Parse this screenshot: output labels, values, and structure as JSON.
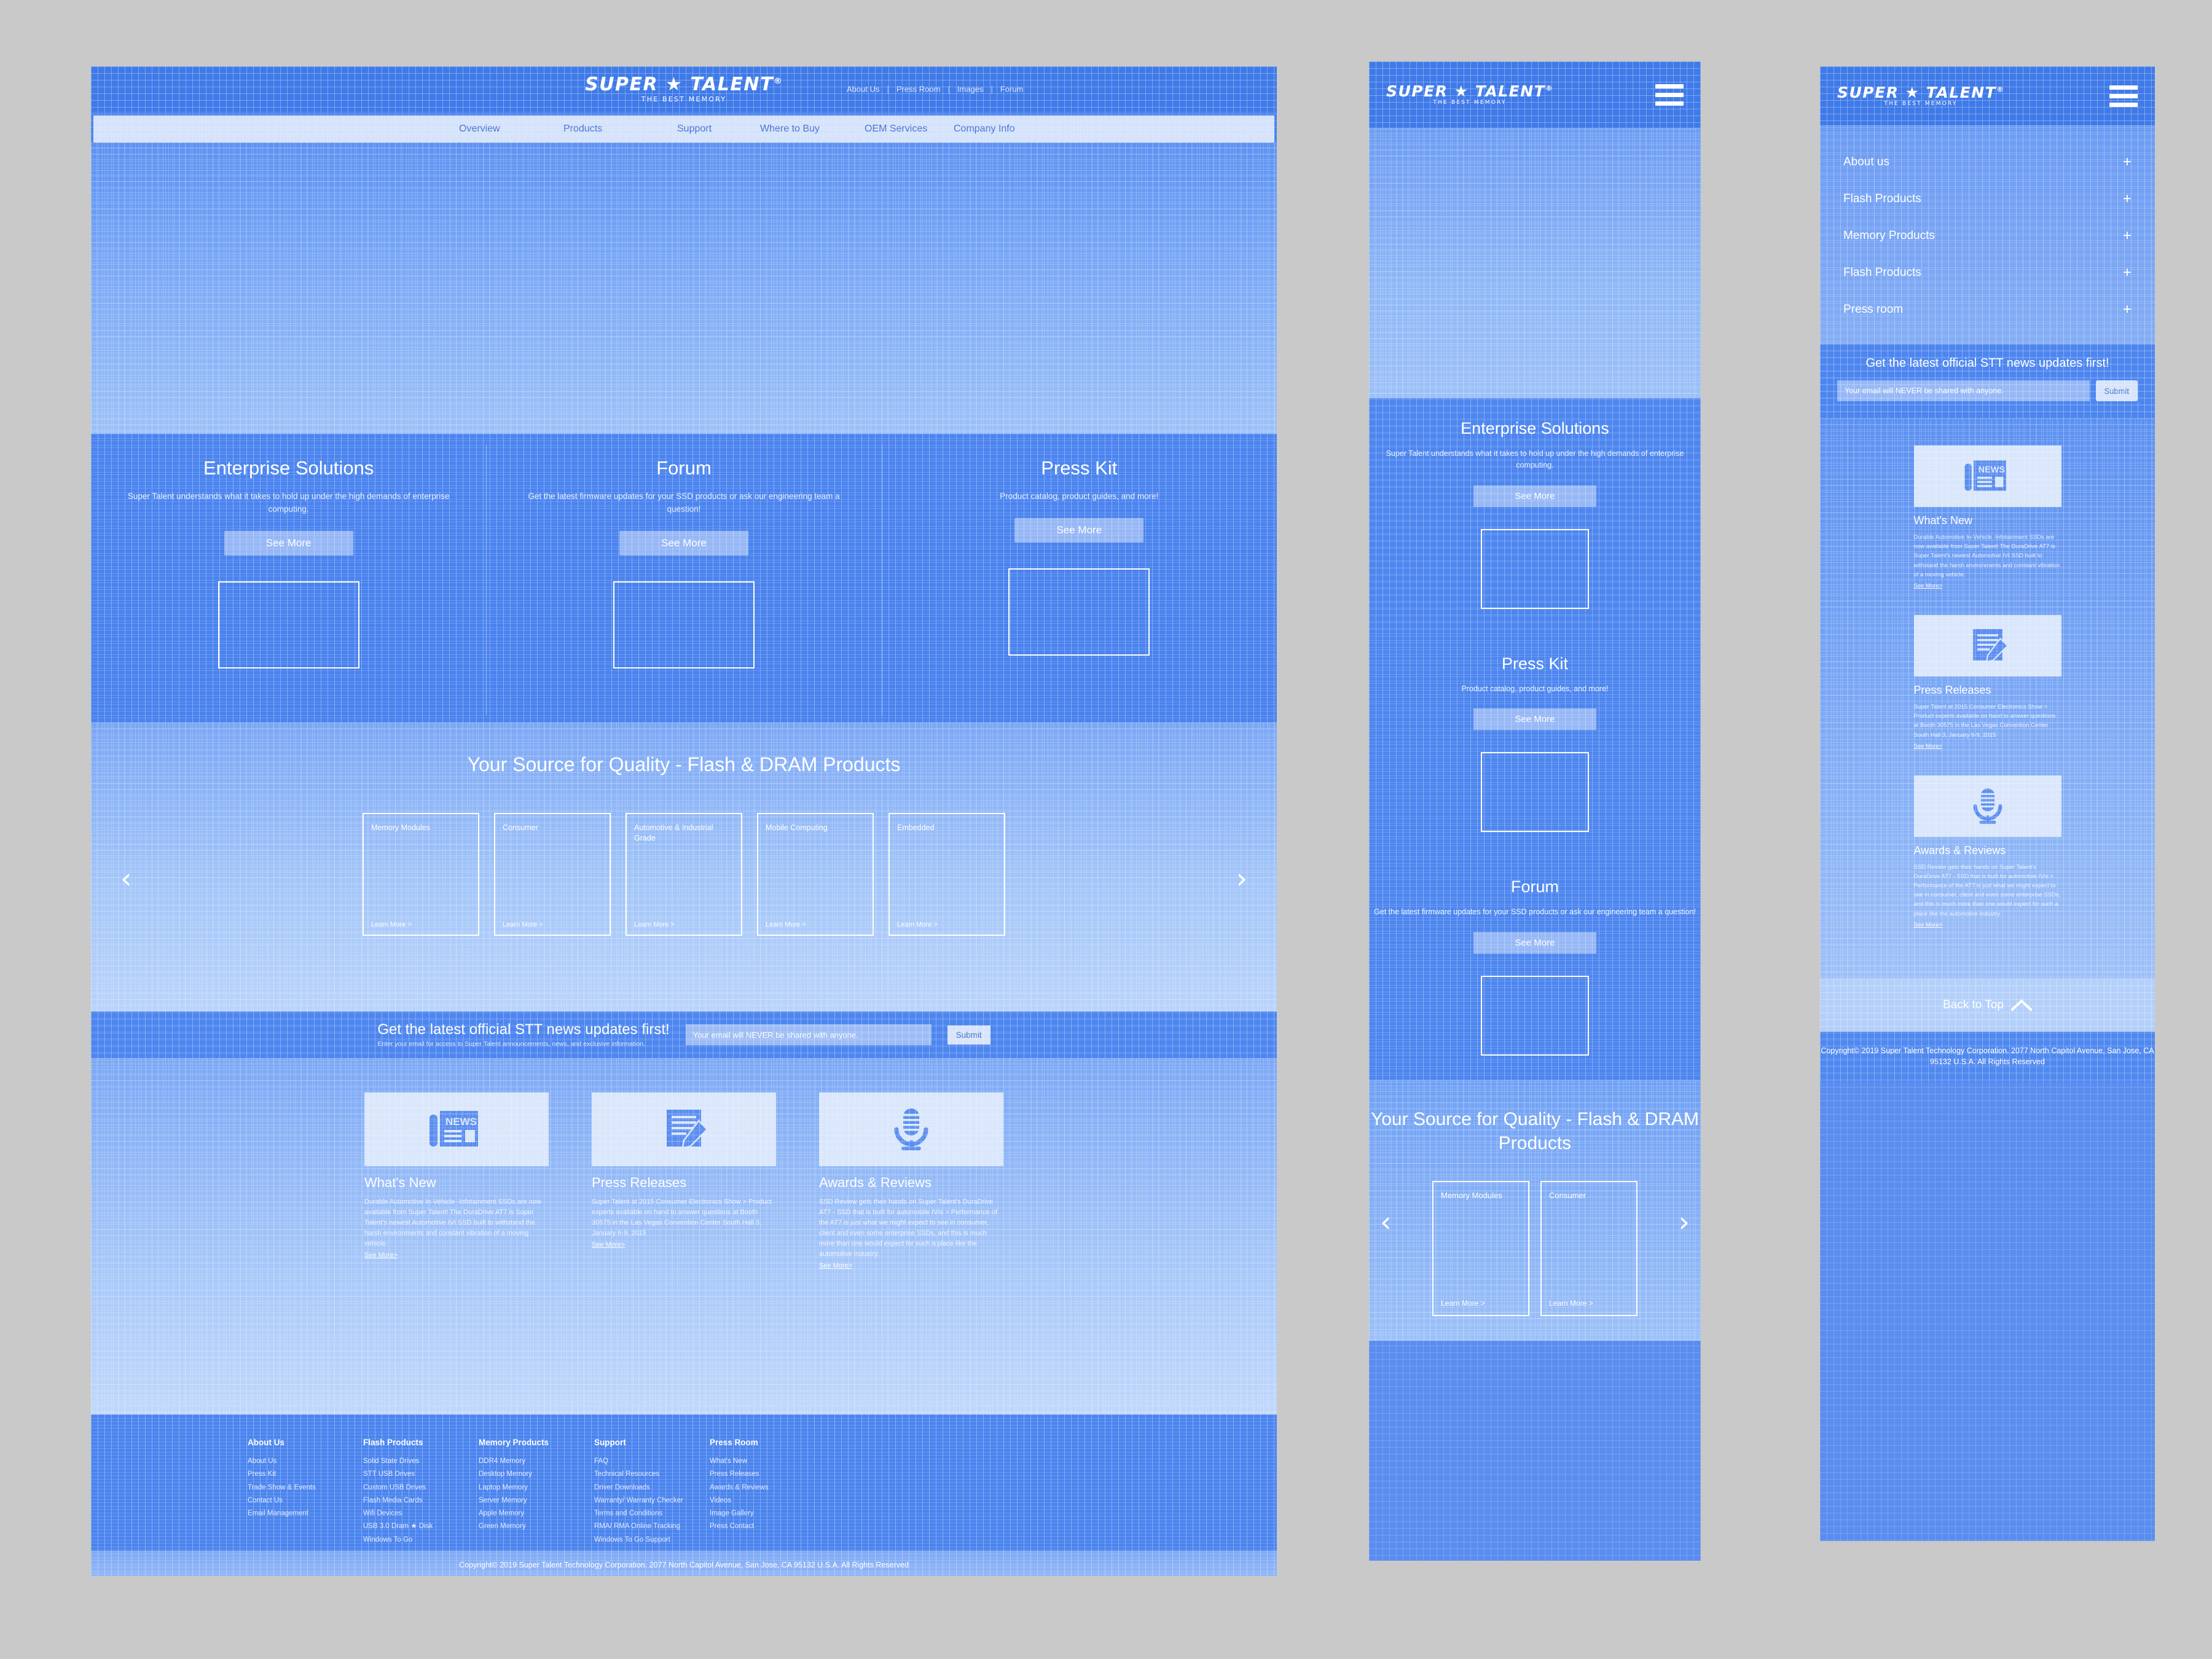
{
  "brand": {
    "name": "SUPER ★ TALENT",
    "registered": "®",
    "tagline": "THE BEST MEMORY"
  },
  "colors": {
    "page_background": "#c9c9c9",
    "primary_blue": "#4d84ee",
    "header_blue": "#3f7ae8",
    "nav_bar_light": "#d4e2fb",
    "nav_link": "#3f6fd0",
    "white": "#ffffff",
    "thumb_background": "#d9e6fb",
    "back_to_top_band": "#b4d0fa"
  },
  "desktop": {
    "utility_nav": [
      "About Us",
      "Press Room",
      "Images",
      "Forum"
    ],
    "utility_separator": "|",
    "main_nav": [
      "Overview",
      "Products",
      "Support",
      "Where to Buy",
      "OEM Services",
      "Company Info"
    ],
    "promo_columns": [
      {
        "title": "Enterprise Solutions",
        "body": "Super Talent understands what it takes to hold up under the high demands of enterprise computing.",
        "button": "See More"
      },
      {
        "title": "Forum",
        "body": "Get the latest firmware updates for your SSD products or ask our engineering team a question!",
        "button": "See More"
      },
      {
        "title": "Press Kit",
        "body": "Product catalog, product guides, and more!",
        "button": "See More"
      }
    ],
    "products": {
      "heading": "Your Source for Quality - Flash & DRAM Products",
      "prev_arrow": "‹",
      "next_arrow": "›",
      "learn_more": "Learn More >",
      "cards": [
        "Memory Modules",
        "Consumer",
        "Automotive & Industrial Grade",
        "Mobile Computing",
        "Embedded"
      ]
    },
    "newsletter": {
      "headline": "Get the latest official STT news updates first!",
      "subtext": "Enter your email for access to Super Talent announcements, news, and exclusive information.",
      "placeholder": "Your email will NEVER be shared with anyone.",
      "submit": "Submit"
    },
    "news_cards": [
      {
        "icon": "newspaper-icon",
        "title": "What's New",
        "body": "Durable Automotive In-Vehicle -Infotainment SSDs are now available from Super Talent! The DuraDrive AT7 is Super Talent's newest Automotive IVI SSD built to withstand the harsh environments and constant vibration of a moving vehicle.",
        "link": "See More>"
      },
      {
        "icon": "press-release-icon",
        "title": "Press Releases",
        "body": "Super Talent at 2015 Consumer Electronics Show > Product experts available on hand to answer questions at Booth 30575 in the Las Vegas Convention Center South Hall 3, January 6-9, 2015",
        "link": "See More>"
      },
      {
        "icon": "microphone-icon",
        "title": "Awards & Reviews",
        "body": "SSD Review gets their hands on Super Talent's DuraDrive AT7 - SSD that is built for automobile IVIs > Performance of the AT7 is just what we might expect to see in consumer, client and even some enterprise SSDs, and this is much more than one would expect for such a place like the automotive industry.",
        "link": "See More>"
      }
    ],
    "footer_columns": [
      {
        "heading": "About Us",
        "links": [
          "About Us",
          "Press Kit",
          "Trade Show & Events",
          "Contact Us",
          "Email Management"
        ]
      },
      {
        "heading": "Flash Products",
        "links": [
          "Solid State Drives",
          "STT USB Drives",
          "Custom USB Drives",
          "Flash Media Cards",
          "Wifi Devices",
          "USB 3.0 Dram ★ Disk",
          "Windows To Go"
        ]
      },
      {
        "heading": "Memory Products",
        "links": [
          "DDR4 Memory",
          "Desktop Memory",
          "Laptop Memory",
          "Server Memory",
          "Apple Memory",
          "Green Memory"
        ]
      },
      {
        "heading": "Support",
        "links": [
          "FAQ",
          "Technical Resources",
          "Driver Downloads",
          "Warranty/ Warranty Checker",
          "Terms and Conditions",
          "RMA/ RMA Online Tracking",
          "Windows To Go Support"
        ]
      },
      {
        "heading": "Press Room",
        "links": [
          "What's New",
          "Press Releases",
          "Awards & Reviews",
          "Videos",
          "Image Gallery",
          "Press Contact"
        ]
      }
    ],
    "copyright": "Copyright© 2019 Super Talent Technology Corporation.  2077 North Capitol Avenue, San Jose, CA 95132 U.S.A.  All Rights Reserved"
  },
  "mobile_center": {
    "promo_blocks": [
      {
        "title": "Enterprise Solutions",
        "body": "Super Talent understands what it takes to hold up under the high demands of enterprise computing.",
        "button": "See More"
      },
      {
        "title": "Press Kit",
        "body": "Product catalog, product guides, and more!",
        "button": "See More"
      },
      {
        "title": "Forum",
        "body": "Get the latest firmware updates for your SSD products or ask our engineering team a question!",
        "button": "See More"
      }
    ],
    "products": {
      "heading": "Your Source for Quality - Flash & DRAM Products",
      "prev_arrow": "‹",
      "next_arrow": "›",
      "learn_more": "Learn More >",
      "cards": [
        "Memory Modules",
        "Consumer"
      ]
    }
  },
  "mobile_right": {
    "menu_items": [
      {
        "label": "About us",
        "expander": "+"
      },
      {
        "label": "Flash Products",
        "expander": "+"
      },
      {
        "label": "Memory Products",
        "expander": "+"
      },
      {
        "label": "Flash Products",
        "expander": "+"
      },
      {
        "label": "Press room",
        "expander": "+"
      }
    ],
    "newsletter": {
      "headline": "Get the latest official STT news updates first!",
      "placeholder": "Your email will NEVER be shared with anyone.",
      "submit": "Submit"
    },
    "news_cards": [
      {
        "icon": "newspaper-icon",
        "title": "What's New",
        "body": "Durable Automotive In-Vehicle -Infotainment SSDs are now available from Super Talent! The DuraDrive AT7 is Super Talent's newest Automotive IVI SSD built to withstand the harsh environments and constant vibration of a moving vehicle.",
        "link": "See More>"
      },
      {
        "icon": "press-release-icon",
        "title": "Press Releases",
        "body": "Super Talent at 2015 Consumer Electronics Show > Product experts available on hand to answer questions at Booth 30575 in the Las Vegas Convention Center South Hall 3, January 6-9, 2015",
        "link": "See More>"
      },
      {
        "icon": "microphone-icon",
        "title": "Awards & Reviews",
        "body": "SSD Review gets their hands on Super Talent's DuraDrive AT7 - SSD that is built for automobile IVIs > Performance of the AT7 is just what we might expect to see in consumer, client and even some enterprise SSDs, and this is much more than one would expect for such a place like the automotive industry.",
        "link": "See More>"
      }
    ],
    "back_to_top": "Back to Top",
    "copyright": "Copyright© 2019 Super Talent Technology Corporation. 2077 North Capitol Avenue, San Jose, CA 95132 U.S.A. All Rights Reserved"
  }
}
